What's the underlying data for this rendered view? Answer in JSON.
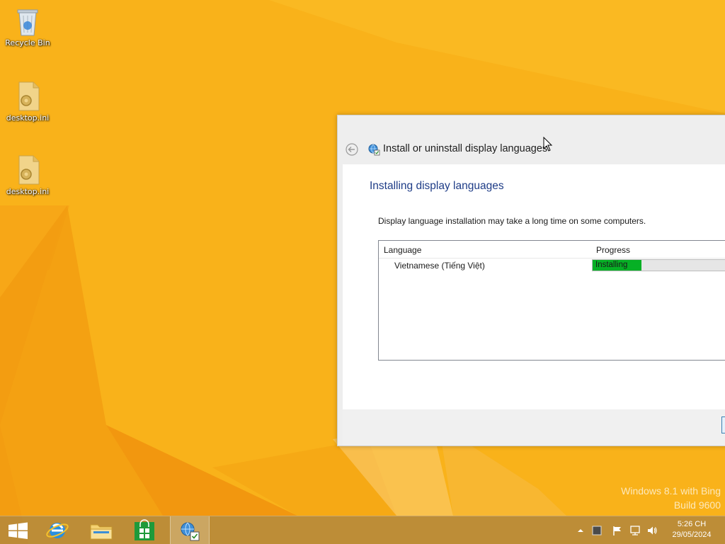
{
  "desktop": {
    "icons": [
      {
        "label": "Recycle Bin",
        "icon": "recycle-bin-icon"
      },
      {
        "label": "desktop.ini",
        "icon": "settings-file-icon"
      },
      {
        "label": "desktop.ini",
        "icon": "settings-file-icon"
      }
    ],
    "background_color": "#f9b21a"
  },
  "dialog": {
    "title": "Install or uninstall display languages",
    "heading": "Installing display languages",
    "description": "Display language installation may take a long time on some computers.",
    "table": {
      "columns": [
        "Language",
        "Progress"
      ],
      "rows": [
        {
          "language": "Vietnamese (Tiếng Việt)",
          "status": "Installing",
          "progress": 0.33
        }
      ]
    },
    "accent_color": "#1e3c87",
    "progress_color": "#06b025"
  },
  "watermark": {
    "line1": "Windows 8.1 with Bing",
    "line2": "Build 9600"
  },
  "taskbar": {
    "buttons": [
      {
        "name": "start",
        "icon": "windows-logo-icon"
      },
      {
        "name": "internet-explorer",
        "icon": "internet-explorer-icon"
      },
      {
        "name": "file-explorer",
        "icon": "folder-icon"
      },
      {
        "name": "store",
        "icon": "store-icon"
      },
      {
        "name": "language-install",
        "icon": "language-install-icon",
        "active": true
      }
    ],
    "tray": {
      "icons": [
        "show-hidden-icons-icon",
        "action-center-square-icon",
        "flag-icon",
        "network-icon",
        "volume-icon"
      ]
    },
    "clock": {
      "time": "5:26 CH",
      "date": "29/05/2024"
    }
  }
}
